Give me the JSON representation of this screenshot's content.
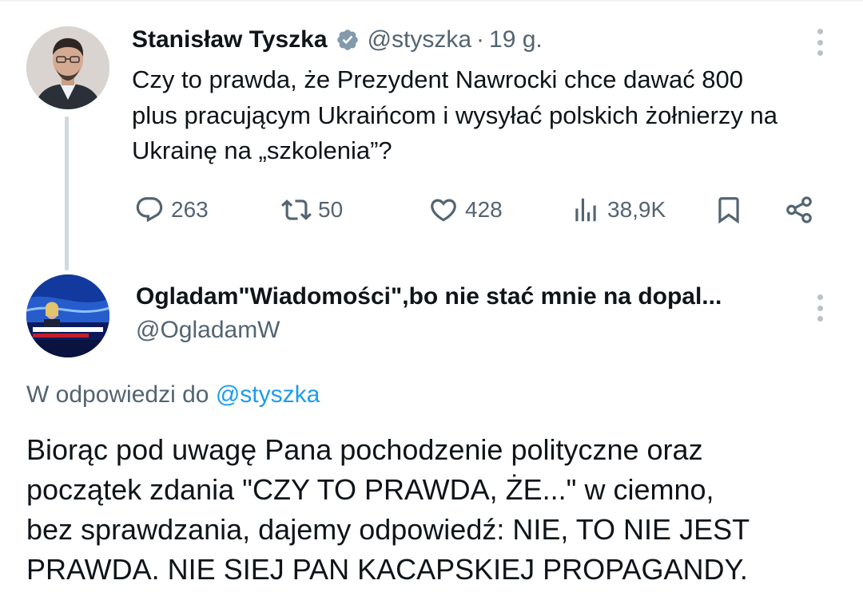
{
  "parent_tweet": {
    "author_name": "Stanisław Tyszka",
    "handle": "@styszka",
    "separator": "·",
    "time": "19 g.",
    "text": "Czy to prawda, że Prezydent Nawrocki chce dawać 800\nplus pracującym Ukraińcom i wysyłać polskich żołnierzy na\nUkrainę na „szkolenia”?",
    "actions": {
      "replies": "263",
      "reposts": "50",
      "likes": "428",
      "views": "38,9K"
    },
    "icons": [
      "verified-badge-icon",
      "more-icon",
      "reply-icon",
      "repost-icon",
      "like-icon",
      "views-icon",
      "bookmark-icon",
      "share-icon"
    ]
  },
  "reply_tweet": {
    "author_name": "Ogladam\"Wiadomości\",bo nie stać mnie na dopal...",
    "handle": "@OgladamW",
    "reply_prefix": "W odpowiedzi do",
    "reply_mention": "@styszka",
    "text": "Biorąc pod uwagę Pana pochodzenie polityczne oraz\npoczątek zdania \"CZY TO PRAWDA, ŻE...\" w ciemno,\nbez sprawdzania, dajemy odpowiedź: NIE, TO NIE JEST\nPRAWDA. NIE SIEJ PAN KACAPSKIEJ PROPAGANDY."
  },
  "colors": {
    "text": "#0f1419",
    "secondary": "#536471",
    "link": "#1d9bf0",
    "thread_line": "#cfd9de",
    "verified_badge": "#829aab"
  }
}
